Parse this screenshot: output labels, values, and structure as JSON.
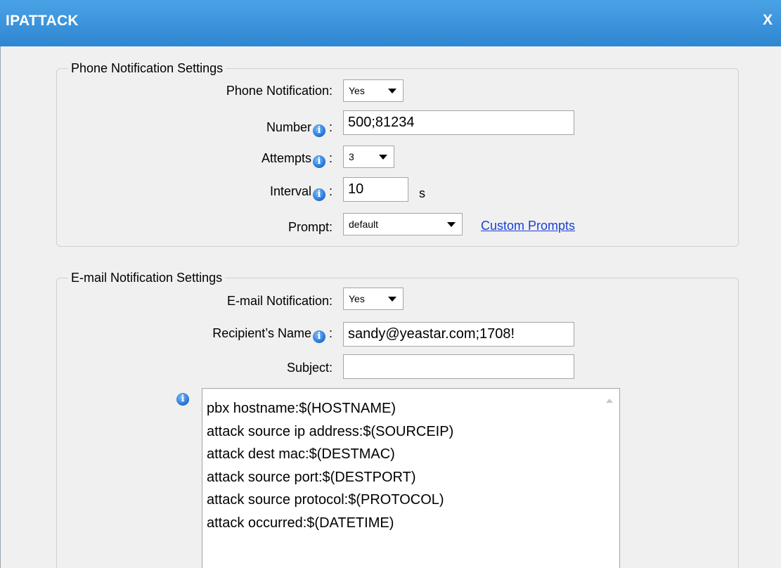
{
  "window": {
    "title": "IPATTACK",
    "close_label": "X"
  },
  "phone": {
    "legend": "Phone Notification Settings",
    "notification_label": "Phone Notification:",
    "notification_value": "Yes",
    "number_label": "Number",
    "number_value": "500;81234",
    "attempts_label": "Attempts",
    "attempts_value": "3",
    "interval_label": "Interval",
    "interval_value": "10",
    "interval_unit": "s",
    "prompt_label": "Prompt:",
    "prompt_value": "default",
    "custom_prompts_link": "Custom Prompts",
    "colon": ":"
  },
  "email": {
    "legend": "E-mail Notification Settings",
    "notification_label": "E-mail Notification:",
    "notification_value": "Yes",
    "recipient_label": "Recipient’s Name",
    "recipient_value": "sandy@yeastar.com;1708!",
    "subject_label": "Subject:",
    "subject_value": "",
    "body_lines": [
      "pbx hostname:$(HOSTNAME)",
      "attack source ip address:$(SOURCEIP)",
      "attack dest mac:$(DESTMAC)",
      "attack source port:$(DESTPORT)",
      "attack source protocol:$(PROTOCOL)",
      "attack occurred:$(DATETIME)"
    ]
  },
  "icons": {
    "info": "info-icon",
    "close": "close-icon"
  },
  "colors": {
    "titlebar": "#2f86d1",
    "link": "#1a3fd6"
  }
}
